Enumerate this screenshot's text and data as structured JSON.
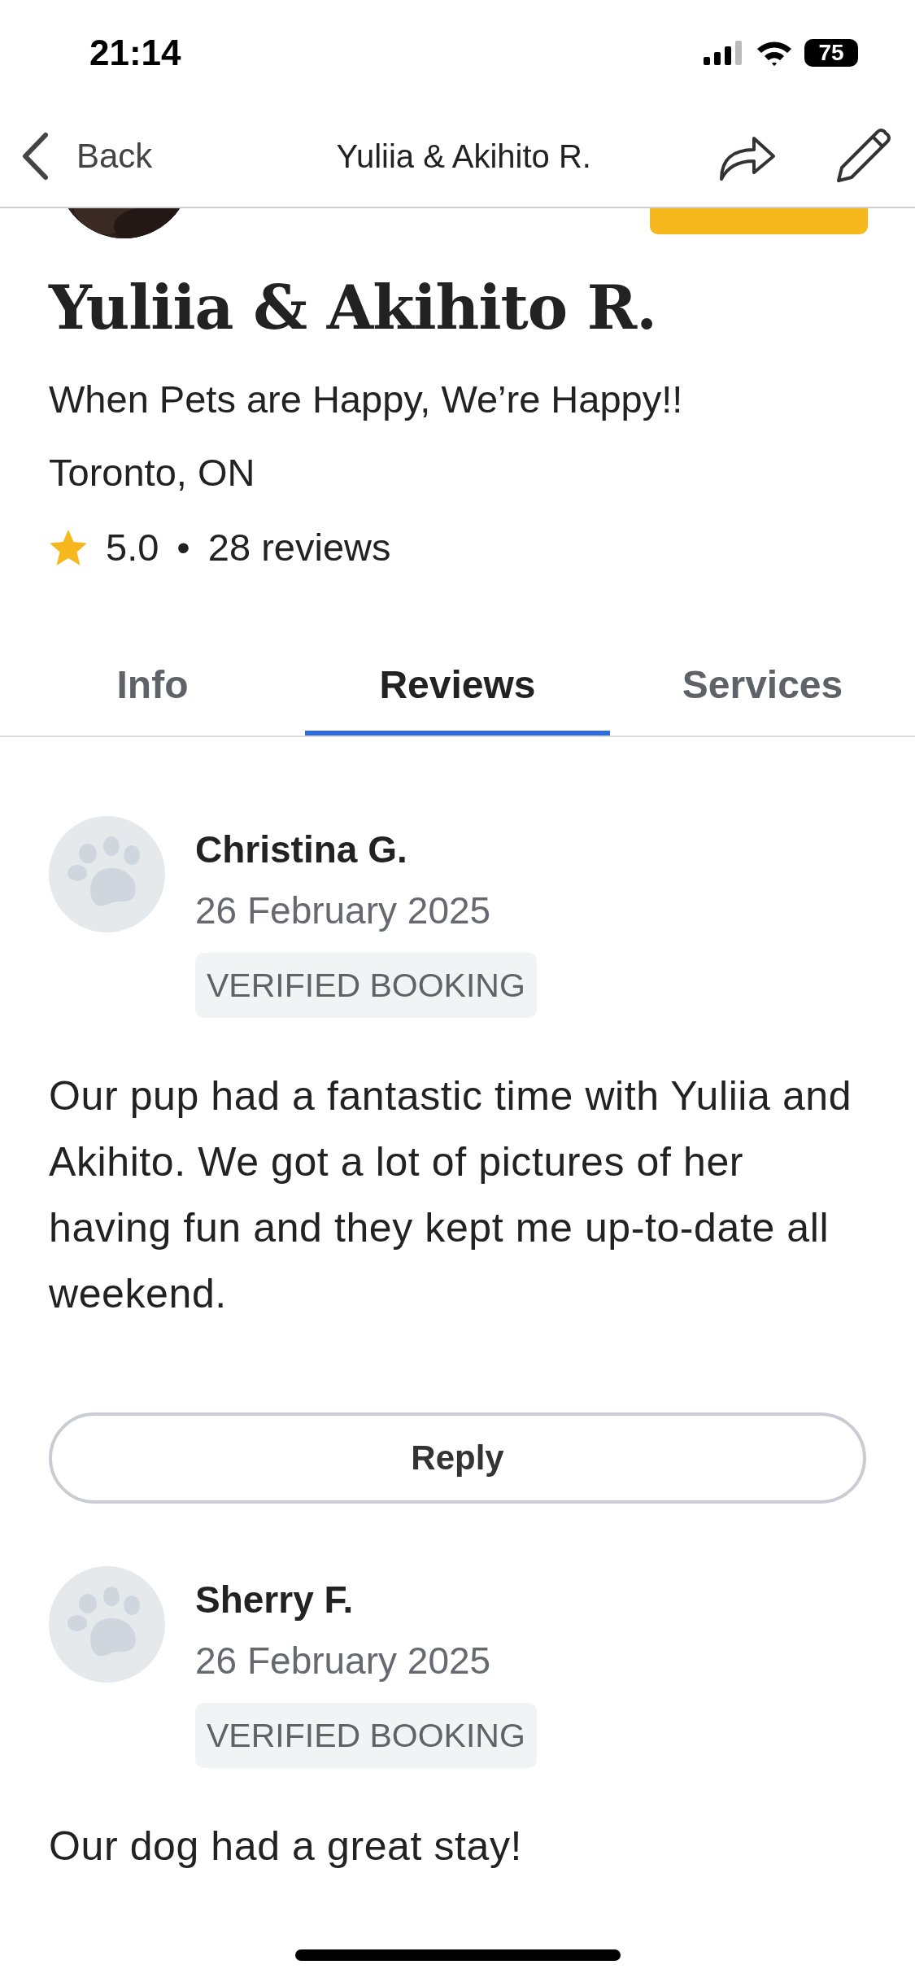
{
  "status_bar": {
    "time": "21:14",
    "battery": "75"
  },
  "nav": {
    "back": "Back",
    "title": "Yuliia & Akihito R."
  },
  "profile": {
    "name": "Yuliia & Akihito R.",
    "tagline": "When Pets are Happy, We’re Happy!!",
    "location": "Toronto, ON",
    "rating": "5.0",
    "separator": "•",
    "reviews_count": "28 reviews"
  },
  "tabs": [
    {
      "label": "Info",
      "selected": false
    },
    {
      "label": "Reviews",
      "selected": true
    },
    {
      "label": "Services",
      "selected": false
    }
  ],
  "reviews": [
    {
      "author": "Christina G.",
      "date": "26 February 2025",
      "tag": "VERIFIED BOOKING",
      "text": "Our pup had a fantastic time with Yuliia and Akihito. We got a lot of pictures of her having fun and they kept me up-to-date all weekend.",
      "reply_button": "Reply"
    },
    {
      "author": "Sherry F.",
      "date": "26 February 2025",
      "tag": "VERIFIED BOOKING",
      "text": "Our dog had a great stay!"
    }
  ]
}
